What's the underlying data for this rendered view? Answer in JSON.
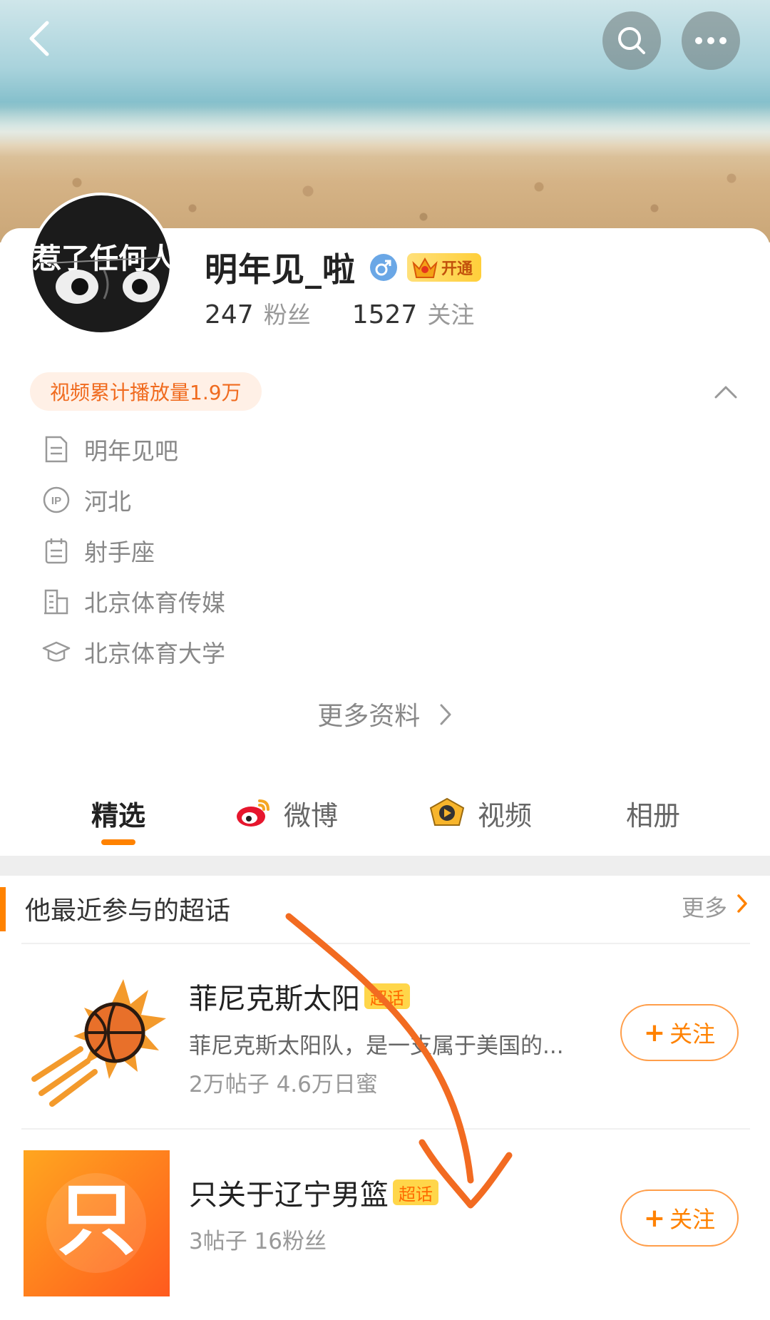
{
  "profile": {
    "avatar_text": "惹了任何人",
    "name": "明年见_啦",
    "vip_label": "开通",
    "followers_count": "247",
    "followers_label": "粉丝",
    "following_count": "1527",
    "following_label": "关注",
    "video_plays": "视频累计播放量1.9万"
  },
  "info": [
    {
      "icon": "document-icon",
      "text": "明年见吧"
    },
    {
      "icon": "ip-icon",
      "text": "河北"
    },
    {
      "icon": "calendar-icon",
      "text": "射手座"
    },
    {
      "icon": "building-icon",
      "text": "北京体育传媒"
    },
    {
      "icon": "graduation-cap-icon",
      "text": "北京体育大学"
    }
  ],
  "more_info_label": "更多资料",
  "tabs": [
    {
      "label": "精选",
      "active": true
    },
    {
      "label": "微博",
      "icon": "weibo-icon"
    },
    {
      "label": "视频",
      "icon": "video-icon"
    },
    {
      "label": "相册"
    }
  ],
  "super_topics": {
    "title": "他最近参与的超话",
    "more_label": "更多",
    "items": [
      {
        "name": "菲尼克斯太阳",
        "badge": "超话",
        "desc": "菲尼克斯太阳队，是一支属于美国的...",
        "meta": "2万帖子 4.6万日蜜",
        "follow_label": "关注"
      },
      {
        "name": "只关于辽宁男篮",
        "badge": "超话",
        "thumb_char": "只",
        "meta": "3帖子 16粉丝",
        "follow_label": "关注"
      }
    ]
  },
  "colors": {
    "accent": "#ff8200",
    "annotation": "#f26b21"
  }
}
